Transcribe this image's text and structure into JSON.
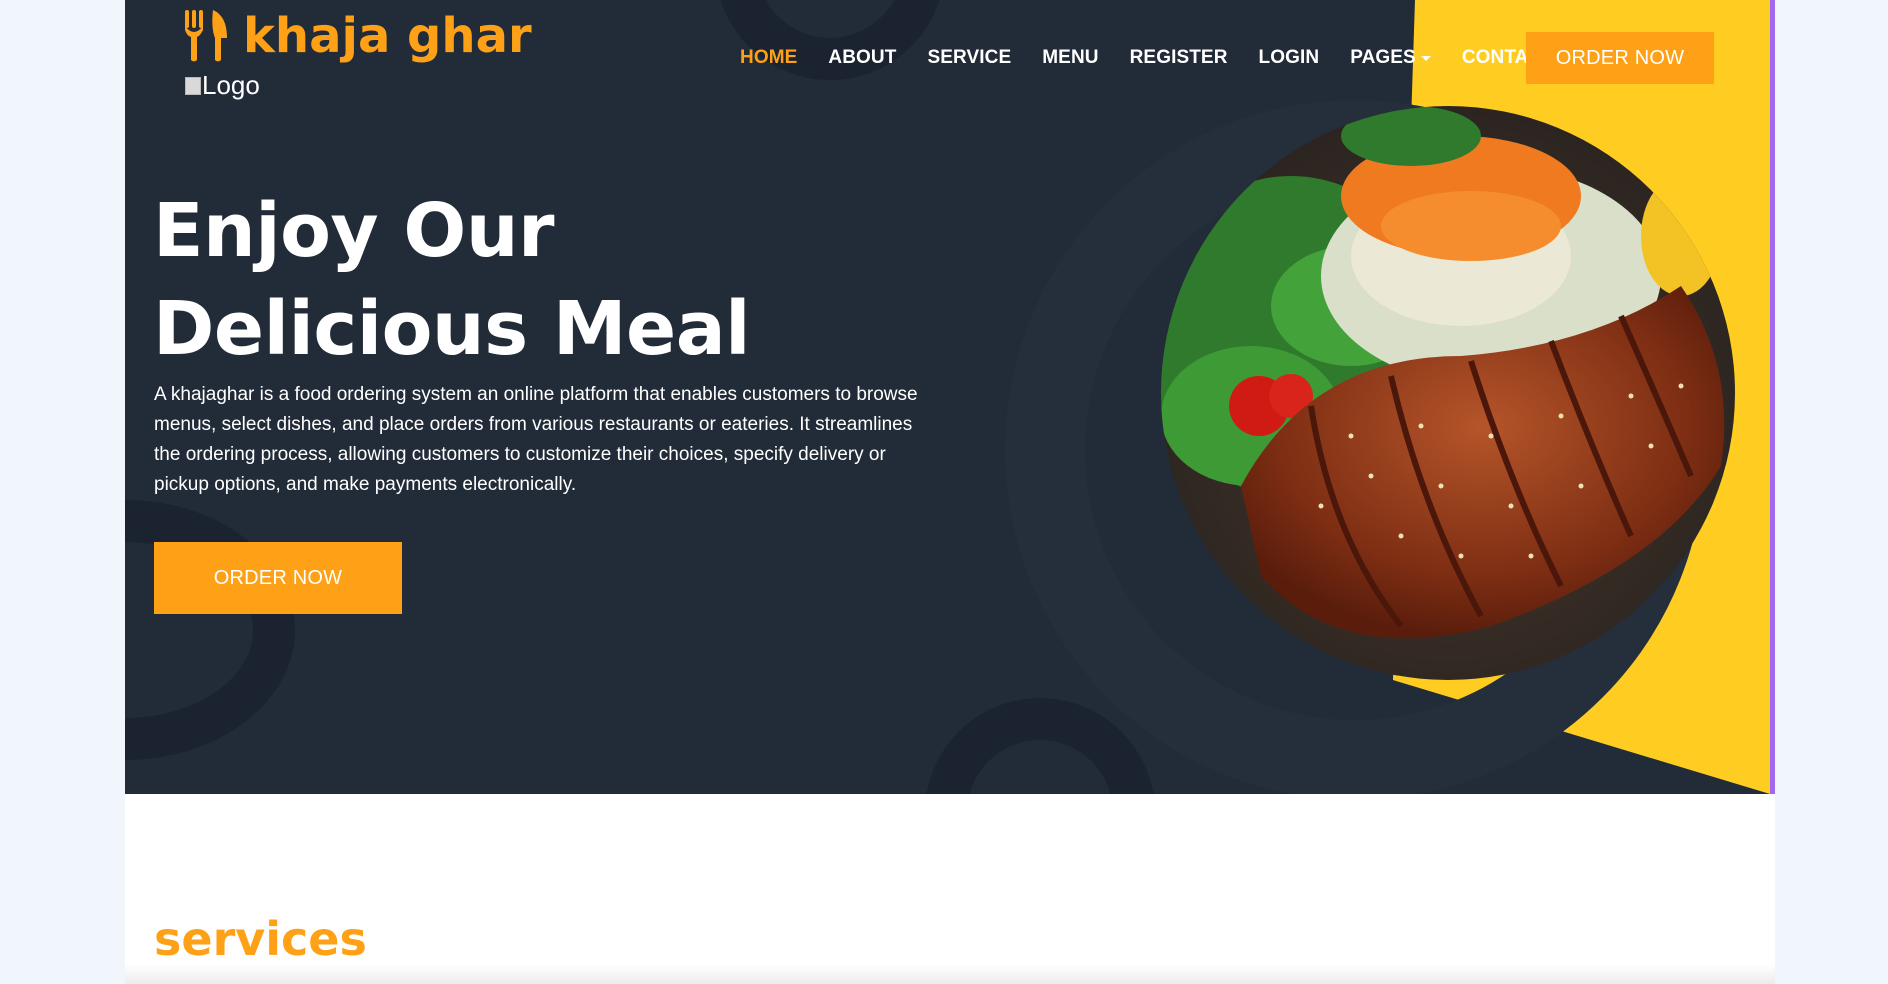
{
  "brand": {
    "name": "khaja ghar",
    "logo_alt": "Logo",
    "icon": "utensils-icon"
  },
  "nav": {
    "items": [
      {
        "label": "HOME",
        "active": true
      },
      {
        "label": "ABOUT"
      },
      {
        "label": "SERVICE"
      },
      {
        "label": "MENU"
      },
      {
        "label": "REGISTER"
      },
      {
        "label": "LOGIN"
      },
      {
        "label": "PAGES",
        "dropdown": true
      },
      {
        "label": "CONTACT"
      }
    ],
    "order_button": "ORDER NOW"
  },
  "hero": {
    "title_line1": "Enjoy Our",
    "title_line2": "Delicious Meal",
    "description": "A khajaghar is a food ordering system an online platform that enables customers to browse menus, select dishes, and place orders from various restaurants or eateries. It streamlines the ordering process, allowing customers to customize their choices, specify delivery or pickup options, and make payments electronically.",
    "order_button": "ORDER NOW",
    "image": "grilled-chicken-salad-plate"
  },
  "services": {
    "title": "services"
  },
  "colors": {
    "accent": "#fea116",
    "dark": "#222b38",
    "yellow": "#ffcd22"
  }
}
